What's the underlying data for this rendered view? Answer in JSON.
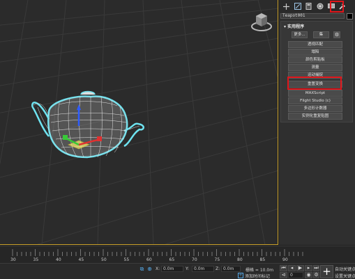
{
  "command_panel": {
    "tabs": [
      {
        "name": "create",
        "icon": "plus-icon"
      },
      {
        "name": "modify",
        "icon": "modify-icon"
      },
      {
        "name": "hierarchy",
        "icon": "hierarchy-icon"
      },
      {
        "name": "motion",
        "icon": "motion-icon"
      },
      {
        "name": "display",
        "icon": "display-icon"
      },
      {
        "name": "utilities",
        "icon": "hammer-icon",
        "active": true
      }
    ],
    "object_name": "Teapot001",
    "object_color": "#000000",
    "rollout": {
      "title": "▾ 实用程序",
      "more_label": "更多...",
      "sets_label": "集",
      "config_icon": "⚙",
      "utilities": [
        "透视匹配",
        "塌陷",
        "颜色剪贴板",
        "测量",
        "运动捕捉",
        "重置变换",
        "MAXScript",
        "Flight Studio (c)",
        "多边形计数器",
        "实例化重复贴图"
      ],
      "highlighted": "重置变换"
    }
  },
  "highlight_color": "#e0151a",
  "timeline": {
    "ticks": [
      "30",
      "35",
      "40",
      "45",
      "50",
      "55",
      "60",
      "65",
      "70",
      "75",
      "80",
      "85",
      "90"
    ]
  },
  "statusbar": {
    "x_label": "X:",
    "x_value": "0.0m",
    "y_label": "Y:",
    "y_value": "0.0m",
    "z_label": "Z:",
    "z_value": "0.0m",
    "grid_text": "栅格 = 10.0m",
    "add_time_tag": "添加时间标记",
    "auto_key": "自动关键点",
    "set_key": "设置关键点",
    "frame_value": "0"
  }
}
